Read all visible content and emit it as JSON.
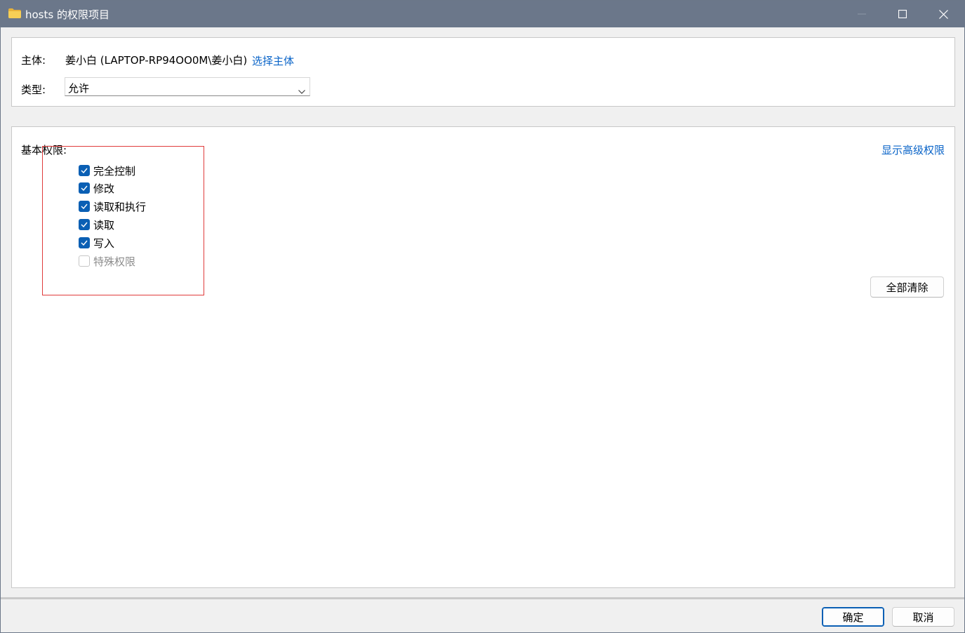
{
  "window": {
    "title": "hosts 的权限项目",
    "icon": "folder-icon",
    "controls": [
      "minimize-icon",
      "maximize-icon",
      "close-icon"
    ]
  },
  "principal": {
    "label": "主体:",
    "value": "姜小白 (LAPTOP-RP94OO0M\\姜小白)",
    "select_link": "选择主体"
  },
  "type": {
    "label": "类型:",
    "selected": "允许"
  },
  "basic_permissions": {
    "label": "基本权限:",
    "advanced_link": "显示高级权限",
    "items": [
      {
        "label": "完全控制",
        "checked": true,
        "enabled": true
      },
      {
        "label": "修改",
        "checked": true,
        "enabled": true
      },
      {
        "label": "读取和执行",
        "checked": true,
        "enabled": true
      },
      {
        "label": "读取",
        "checked": true,
        "enabled": true
      },
      {
        "label": "写入",
        "checked": true,
        "enabled": true
      },
      {
        "label": "特殊权限",
        "checked": false,
        "enabled": false
      }
    ],
    "clear_all_label": "全部清除"
  },
  "footer": {
    "ok_label": "确定",
    "cancel_label": "取消"
  },
  "colors": {
    "titlebar": "#6b778a",
    "accent": "#0a5fb4",
    "link": "#0a64c8",
    "highlight": "#e03c3c"
  }
}
